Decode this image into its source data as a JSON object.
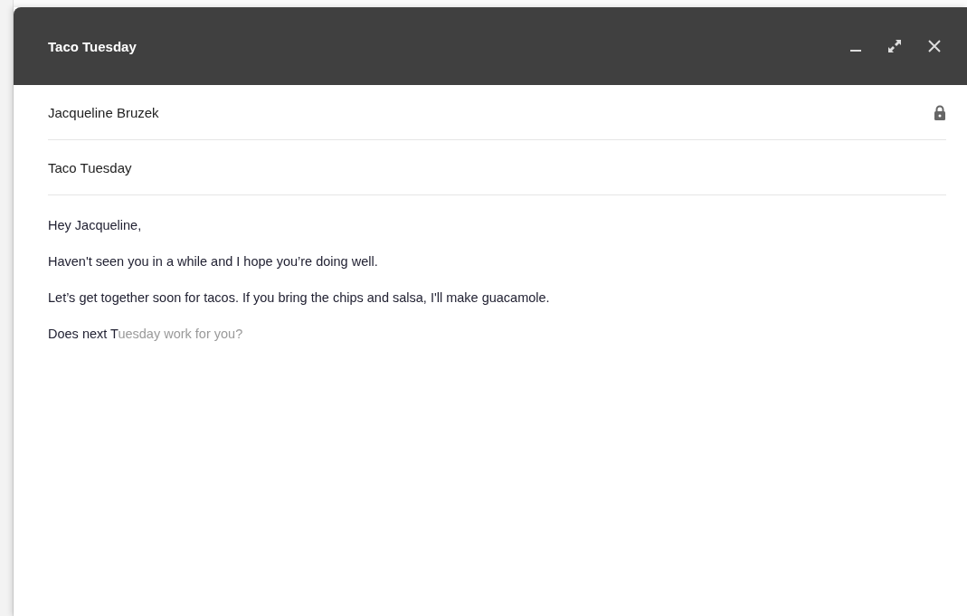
{
  "window": {
    "title": "Taco Tuesday"
  },
  "header_controls": [
    {
      "kind": "minimize"
    },
    {
      "kind": "fullscreen"
    },
    {
      "kind": "close"
    }
  ],
  "recipient": {
    "value": "Jacqueline Bruzek",
    "locked": true
  },
  "subject": {
    "value": "Taco Tuesday"
  },
  "body": {
    "paragraphs": [
      {
        "text": "Hey Jacqueline,"
      },
      {
        "text": "Haven't seen you in a while and I hope you’re doing well."
      },
      {
        "text": "Let’s get together soon for tacos. If you bring the chips and salsa, I'll make guacamole."
      },
      {
        "text": "Does next T",
        "suggestion": "uesday work for you?"
      }
    ]
  }
}
